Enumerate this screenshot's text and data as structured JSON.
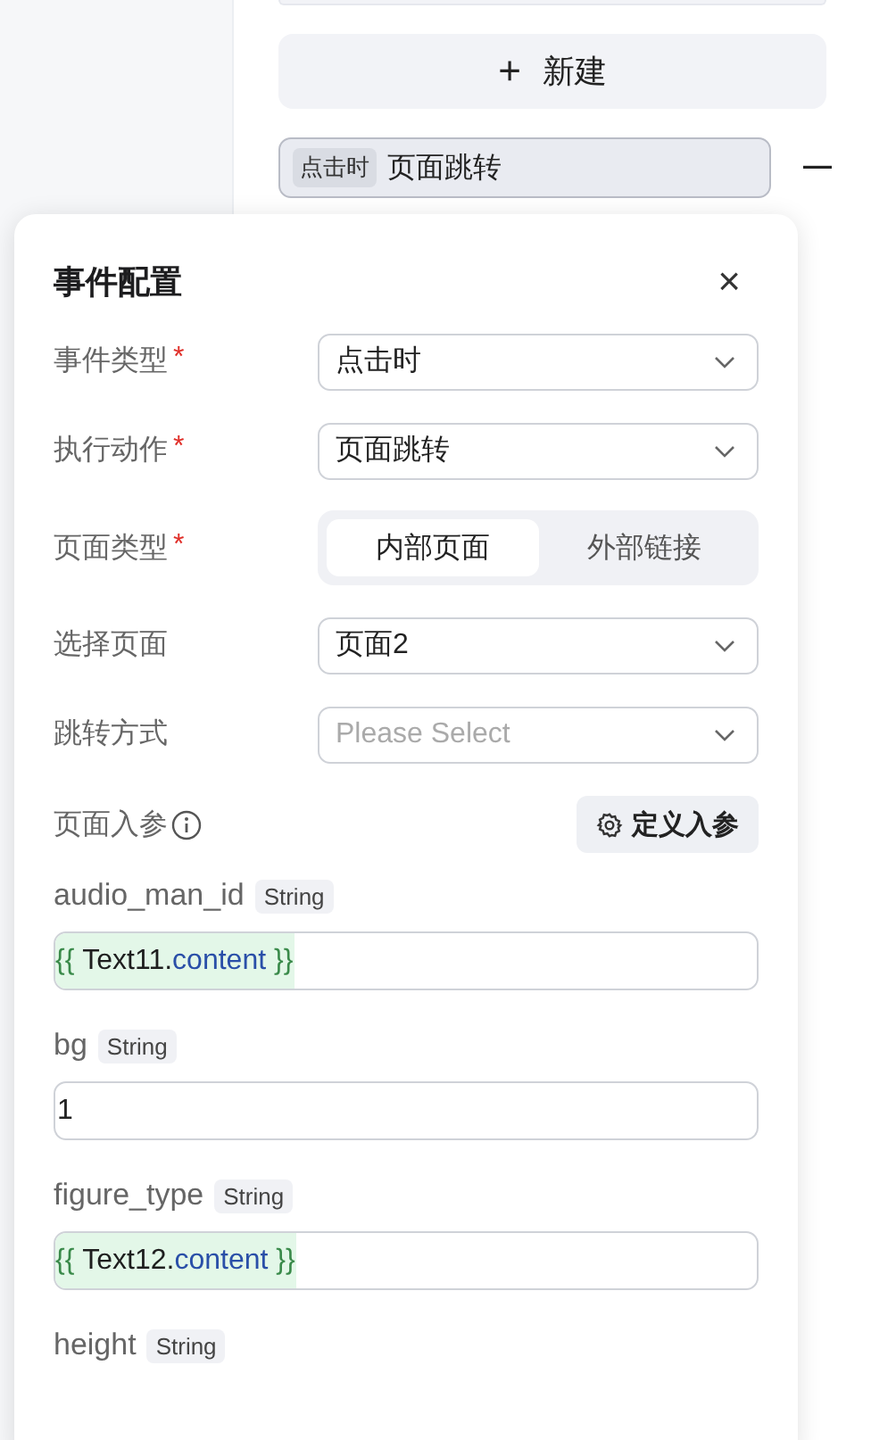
{
  "new_button": {
    "icon": "+",
    "label": "新建"
  },
  "event_item": {
    "trigger": "点击时",
    "action": "页面跳转",
    "remove": "—"
  },
  "dialog": {
    "title": "事件配置",
    "close": "×",
    "required_mark": "*",
    "fields": [
      {
        "kind": "select",
        "label": "事件类型",
        "required": true,
        "value": "点击时"
      },
      {
        "kind": "select",
        "label": "执行动作",
        "required": true,
        "value": "页面跳转"
      },
      {
        "kind": "segmented",
        "label": "页面类型",
        "required": true,
        "options": [
          {
            "label": "内部页面",
            "selected": true
          },
          {
            "label": "外部链接",
            "selected": false
          }
        ]
      },
      {
        "kind": "select",
        "label": "选择页面",
        "required": false,
        "value": "页面2"
      },
      {
        "kind": "select",
        "label": "跳转方式",
        "required": false,
        "placeholder": "Please Select"
      }
    ],
    "params_label": "页面入参",
    "params_button": "定义入参",
    "params": [
      {
        "name": "audio_man_id",
        "type": "String",
        "kind": "binding",
        "parts": [
          {
            "kind": "brace",
            "text": "{{ "
          },
          {
            "kind": "object",
            "text": "Text11."
          },
          {
            "kind": "property",
            "text": "content"
          },
          {
            "kind": "brace",
            "text": " }}"
          }
        ]
      },
      {
        "name": "bg",
        "type": "String",
        "kind": "plain",
        "value": "1"
      },
      {
        "name": "figure_type",
        "type": "String",
        "kind": "binding",
        "parts": [
          {
            "kind": "brace",
            "text": "{{ "
          },
          {
            "kind": "object",
            "text": "Text12."
          },
          {
            "kind": "property",
            "text": "content"
          },
          {
            "kind": "brace",
            "text": " }}"
          }
        ]
      },
      {
        "name": "height",
        "type": "String",
        "kind": "none"
      }
    ]
  }
}
